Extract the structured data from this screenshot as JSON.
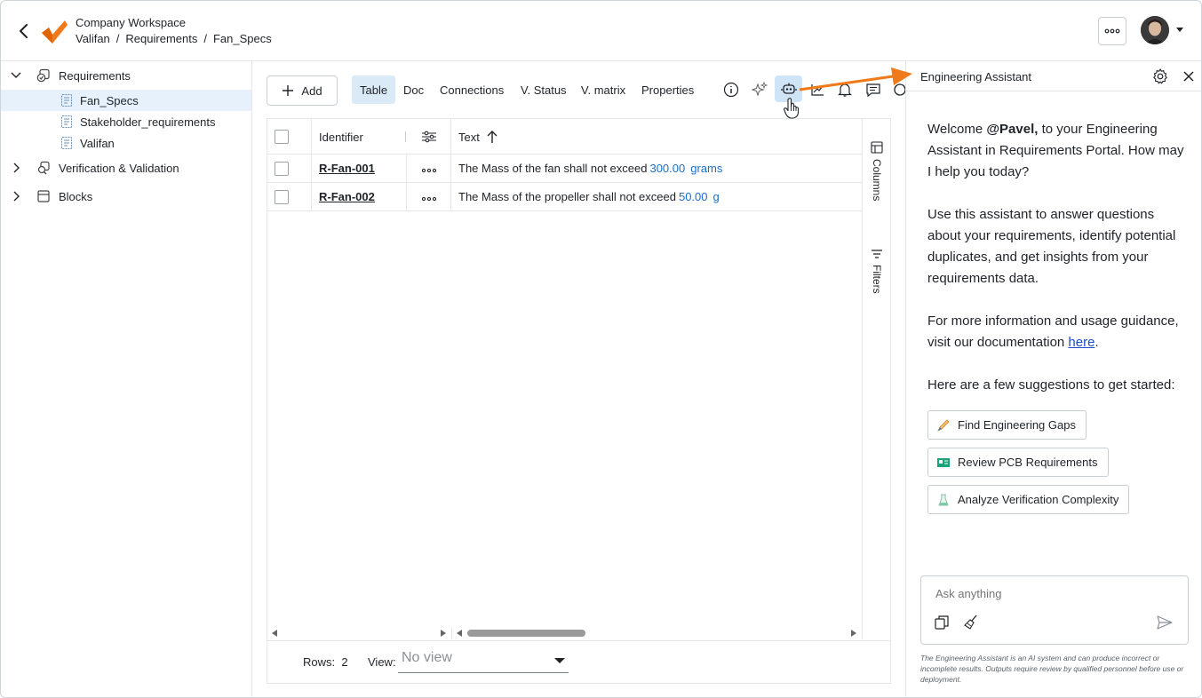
{
  "header": {
    "workspace": "Company Workspace",
    "breadcrumb": [
      "Valifan",
      "Requirements",
      "Fan_Specs"
    ],
    "breadcrumb_sep": "/"
  },
  "sidebar": {
    "items": [
      {
        "label": "Requirements",
        "icon": "requirements-icon",
        "expanded": true
      },
      {
        "label": "Fan_Specs",
        "icon": "document-icon",
        "selected": true
      },
      {
        "label": "Stakeholder_requirements",
        "icon": "document-icon"
      },
      {
        "label": "Valifan",
        "icon": "document-icon"
      },
      {
        "label": "Verification & Validation",
        "icon": "verification-icon",
        "expanded": false
      },
      {
        "label": "Blocks",
        "icon": "block-icon",
        "expanded": false
      }
    ]
  },
  "toolbar": {
    "add_label": "Add",
    "tabs": [
      "Table",
      "Doc",
      "Connections",
      "V. Status",
      "V. matrix",
      "Properties"
    ],
    "active_tab": "Table"
  },
  "table": {
    "columns": {
      "identifier": "Identifier",
      "text": "Text"
    },
    "rows": [
      {
        "id": "R-Fan-001",
        "text": "The Mass of the fan shall not exceed",
        "value": "300.00",
        "unit": "grams"
      },
      {
        "id": "R-Fan-002",
        "text": "The Mass of the propeller shall not exceed",
        "value": "50.00",
        "unit": "g"
      }
    ],
    "side_columns": "Columns",
    "side_filters": "Filters",
    "footer": {
      "rows_label": "Rows:",
      "rows_count": "2",
      "view_label": "View:",
      "view_value": "No view"
    }
  },
  "assistant": {
    "title": "Engineering Assistant",
    "welcome_pre": "Welcome ",
    "user": "@Pavel,",
    "welcome_post": " to your Engineering Assistant in Requirements Portal. How may I help you today?",
    "para2": "Use this assistant to answer questions about your requirements, identify potential duplicates, and get insights from your requirements data.",
    "para3_pre": "For more information and usage guidance, visit our documentation ",
    "para3_link": "here",
    "para3_post": ".",
    "para4": "Here are a few suggestions to get started:",
    "suggestions": [
      {
        "label": "Find Engineering Gaps",
        "icon": "pencil-icon"
      },
      {
        "label": "Review PCB Requirements",
        "icon": "pcb-icon"
      },
      {
        "label": "Analyze Verification Complexity",
        "icon": "flask-icon"
      }
    ],
    "input_placeholder": "Ask anything",
    "disclaimer": "The Engineering Assistant is an AI system and can produce incorrect or incomplete results. Outputs require review by qualified personnel before use or deployment."
  },
  "colors": {
    "accent": "#f07a1a",
    "link": "#1a6fc9",
    "selected": "#e6f1fb"
  }
}
